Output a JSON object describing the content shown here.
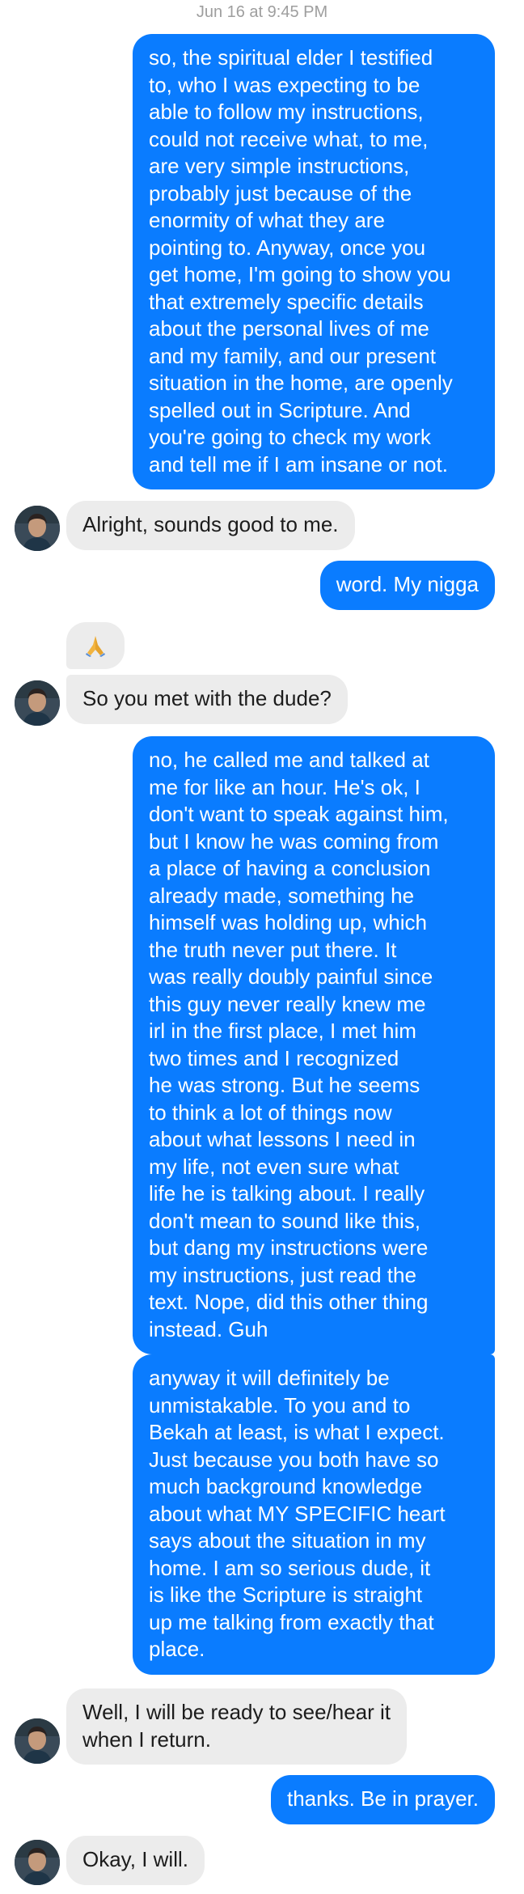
{
  "conversation": {
    "timestamp": "Jun 16 at 9:45 PM",
    "messages": [
      {
        "sender": "me",
        "text": "so, the spiritual elder I testified\nto, who I was expecting to be\nable to follow my instructions,\ncould not receive what, to me,\nare very simple instructions,\nprobably just because of the\nenormity of what they are\npointing to. Anyway, once you\nget home, I'm going to show you\nthat extremely specific details\nabout the personal lives of me\nand my family, and our present\nsituation in the home, are openly\nspelled out in Scripture. And\nyou're going to check my work\nand tell me if I am insane or not."
      },
      {
        "sender": "contact",
        "text": "Alright, sounds good to me."
      },
      {
        "sender": "me",
        "text": "word. My nigga"
      },
      {
        "sender": "contact",
        "text": "🙏",
        "type": "emoji",
        "icon": "praying-hands-icon"
      },
      {
        "sender": "contact",
        "text": "So you met with the dude?"
      },
      {
        "sender": "me",
        "text": "no, he called me and talked at\nme for like an hour. He's ok, I\ndon't want to speak against him,\nbut I know he was coming from\na place of having a conclusion\nalready made, something he\nhimself was holding up, which\nthe truth never put there. It\nwas really doubly painful since\nthis guy never really knew me\nirl in the first place, I met him\ntwo times and I recognized\nhe was strong. But he seems\nto think a lot of things now\nabout what lessons I need in\nmy life, not even sure what\nlife he is talking about. I really\ndon't mean to sound like this,\nbut dang my instructions were\nmy instructions, just read the\ntext. Nope, did this other thing\ninstead. Guh"
      },
      {
        "sender": "me",
        "text": "anyway it will definitely be\nunmistakable. To you and to\nBekah at least, is what I expect.\nJust because you both have so\nmuch background knowledge\nabout what MY SPECIFIC heart\nsays about the situation in my\nhome. I am so serious dude, it\nis like the Scripture is straight\nup me talking from exactly that\nplace."
      },
      {
        "sender": "contact",
        "text": "Well, I will be ready to see/hear it\nwhen I return."
      },
      {
        "sender": "me",
        "text": "thanks. Be in prayer."
      },
      {
        "sender": "contact",
        "text": "Okay, I will."
      }
    ]
  },
  "colors": {
    "sent_bubble": "#0a7cff",
    "received_bubble": "#ececec",
    "timestamp": "#9e9e9e"
  }
}
